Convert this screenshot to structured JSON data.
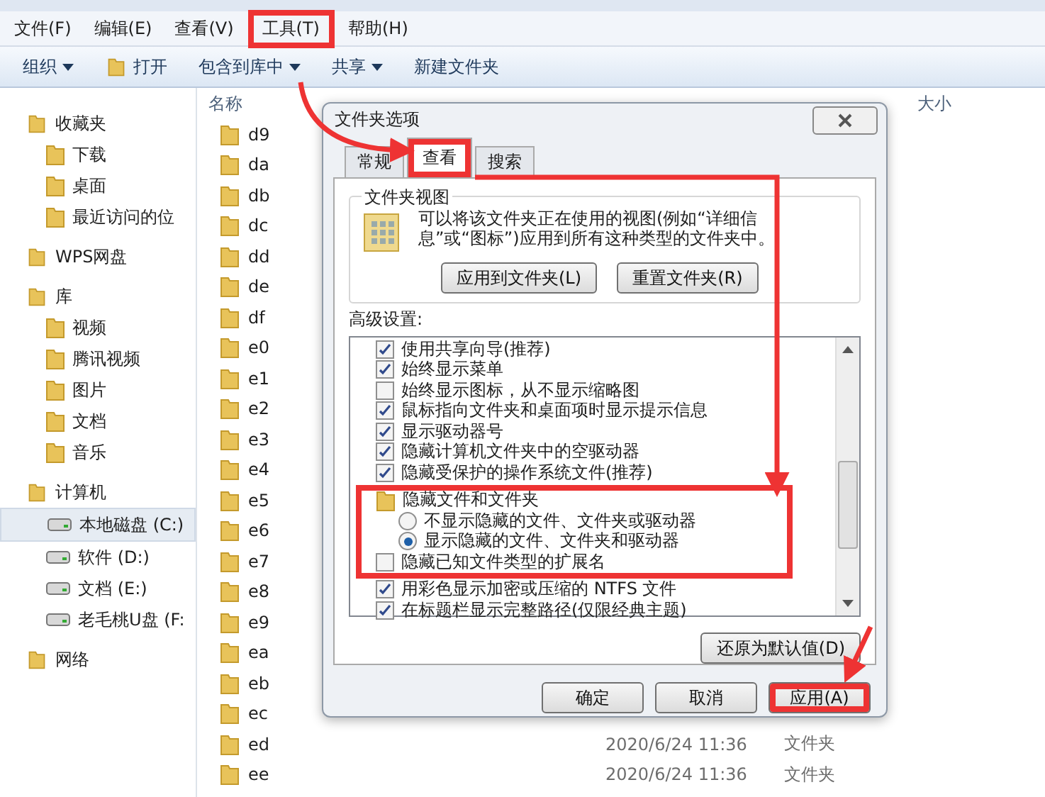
{
  "menu": [
    {
      "label": "文件(F)",
      "highlighted": false
    },
    {
      "label": "编辑(E)",
      "highlighted": false
    },
    {
      "label": "查看(V)",
      "highlighted": false
    },
    {
      "label": "工具(T)",
      "highlighted": true
    },
    {
      "label": "帮助(H)",
      "highlighted": false
    }
  ],
  "toolbar": [
    {
      "label": "组织",
      "dropdown": true,
      "icon": false
    },
    {
      "label": "打开",
      "dropdown": false,
      "icon": true
    },
    {
      "label": "包含到库中",
      "dropdown": true,
      "icon": false
    },
    {
      "label": "共享",
      "dropdown": true,
      "icon": false
    },
    {
      "label": "新建文件夹",
      "dropdown": false,
      "icon": false
    }
  ],
  "sidebar": [
    {
      "kind": "group",
      "label": "收藏夹",
      "selected": false
    },
    {
      "kind": "item",
      "label": "下载",
      "selected": false
    },
    {
      "kind": "item",
      "label": "桌面",
      "selected": false
    },
    {
      "kind": "item",
      "label": "最近访问的位",
      "selected": false
    },
    {
      "kind": "group",
      "label": "WPS网盘",
      "selected": false
    },
    {
      "kind": "group",
      "label": "库",
      "selected": false
    },
    {
      "kind": "item",
      "label": "视频",
      "selected": false
    },
    {
      "kind": "item",
      "label": "腾讯视频",
      "selected": false
    },
    {
      "kind": "item",
      "label": "图片",
      "selected": false
    },
    {
      "kind": "item",
      "label": "文档",
      "selected": false
    },
    {
      "kind": "item",
      "label": "音乐",
      "selected": false
    },
    {
      "kind": "group",
      "label": "计算机",
      "selected": false
    },
    {
      "kind": "drive",
      "label": "本地磁盘 (C:)",
      "selected": true
    },
    {
      "kind": "drive",
      "label": "软件 (D:)",
      "selected": false
    },
    {
      "kind": "drive",
      "label": "文档 (E:)",
      "selected": false
    },
    {
      "kind": "drive",
      "label": "老毛桃U盘 (F:",
      "selected": false
    },
    {
      "kind": "group",
      "label": "网络",
      "selected": false
    }
  ],
  "columns": {
    "name": "名称",
    "size": "大小"
  },
  "files": [
    {
      "name": "d9"
    },
    {
      "name": "da"
    },
    {
      "name": "db"
    },
    {
      "name": "dc"
    },
    {
      "name": "dd"
    },
    {
      "name": "de"
    },
    {
      "name": "df"
    },
    {
      "name": "e0"
    },
    {
      "name": "e1"
    },
    {
      "name": "e2"
    },
    {
      "name": "e3"
    },
    {
      "name": "e4"
    },
    {
      "name": "e5"
    },
    {
      "name": "e6"
    },
    {
      "name": "e7"
    },
    {
      "name": "e8"
    },
    {
      "name": "e9"
    },
    {
      "name": "ea"
    },
    {
      "name": "eb"
    },
    {
      "name": "ec"
    },
    {
      "name": "ed",
      "date": "2020/6/24 11:36",
      "type": "文件夹"
    },
    {
      "name": "ee",
      "date": "2020/6/24 11:36",
      "type": "文件夹"
    }
  ],
  "dialog": {
    "title": "文件夹选项",
    "tabs": [
      {
        "label": "常规",
        "selected": false,
        "highlighted": false
      },
      {
        "label": "查看",
        "selected": true,
        "highlighted": true
      },
      {
        "label": "搜索",
        "selected": false,
        "highlighted": false
      }
    ],
    "folder_views": {
      "title": "文件夹视图",
      "description": "可以将该文件夹正在使用的视图(例如“详细信息”或“图标”)应用到所有这种类型的文件夹中。",
      "buttons": [
        "应用到文件夹(L)",
        "重置文件夹(R)"
      ]
    },
    "advanced_label": "高级设置:",
    "settings": [
      {
        "kind": "checkbox",
        "label": "使用共享向导(推荐)",
        "checked": true,
        "highlighted": false
      },
      {
        "kind": "checkbox",
        "label": "始终显示菜单",
        "checked": true,
        "highlighted": false
      },
      {
        "kind": "checkbox",
        "label": "始终显示图标，从不显示缩略图",
        "checked": false,
        "highlighted": false
      },
      {
        "kind": "checkbox",
        "label": "鼠标指向文件夹和桌面项时显示提示信息",
        "checked": true,
        "highlighted": false
      },
      {
        "kind": "checkbox",
        "label": "显示驱动器号",
        "checked": true,
        "highlighted": false
      },
      {
        "kind": "checkbox",
        "label": "隐藏计算机文件夹中的空驱动器",
        "checked": true,
        "highlighted": false
      },
      {
        "kind": "checkbox",
        "label": "隐藏受保护的操作系统文件(推荐)",
        "checked": true,
        "highlighted": false
      },
      {
        "kind": "folder",
        "label": "隐藏文件和文件夹",
        "highlighted": true
      },
      {
        "kind": "radio",
        "label": "不显示隐藏的文件、文件夹或驱动器",
        "selected": false,
        "highlighted": true
      },
      {
        "kind": "radio",
        "label": "显示隐藏的文件、文件夹和驱动器",
        "selected": true,
        "highlighted": true
      },
      {
        "kind": "checkbox",
        "label": "隐藏已知文件类型的扩展名",
        "checked": false,
        "highlighted": true
      },
      {
        "kind": "checkbox",
        "label": "用彩色显示加密或压缩的 NTFS 文件",
        "checked": true,
        "highlighted": false
      },
      {
        "kind": "checkbox",
        "label": "在标题栏显示完整路径(仅限经典主题)",
        "checked": true,
        "highlighted": false
      }
    ],
    "restore_button": "还原为默认值(D)",
    "buttons": [
      {
        "label": "确定",
        "highlighted": false
      },
      {
        "label": "取消",
        "highlighted": false
      },
      {
        "label": "应用(A)",
        "highlighted": true
      }
    ]
  }
}
